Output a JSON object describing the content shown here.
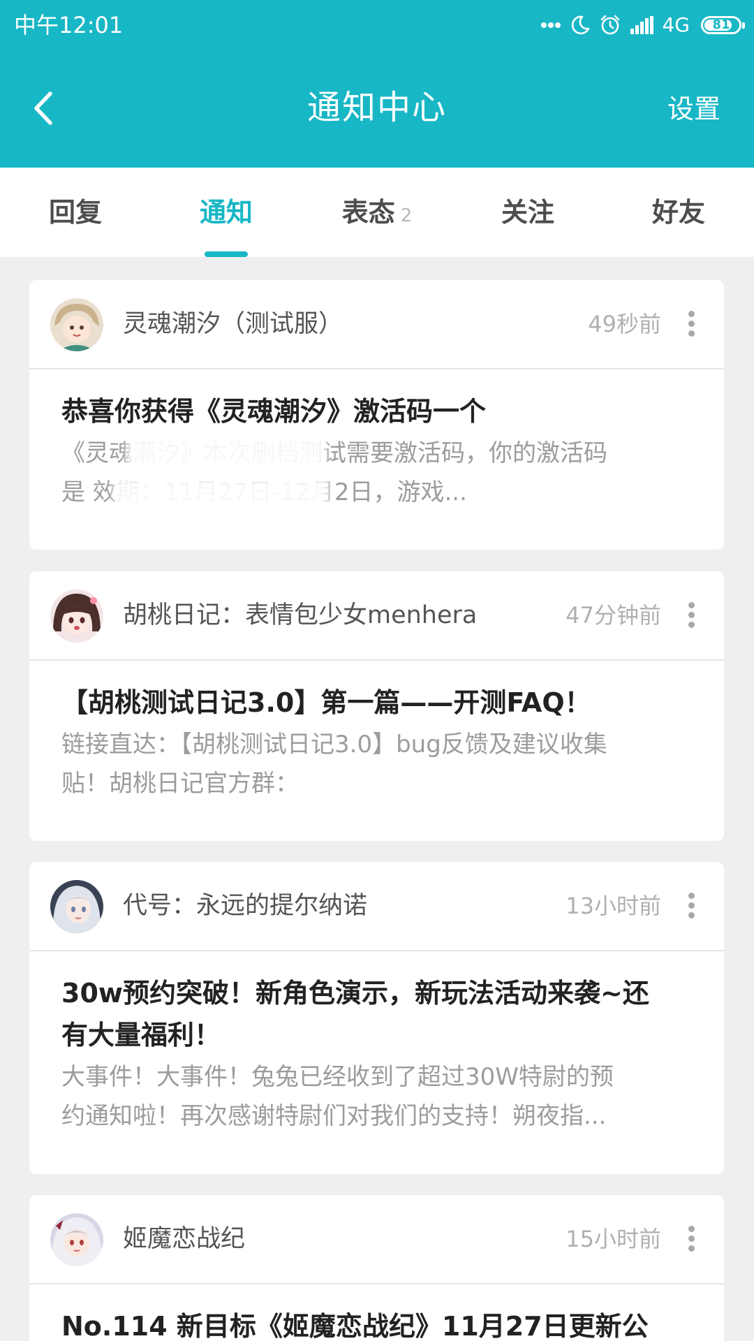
{
  "status_bar": {
    "time": "中午12:01",
    "network": "4G",
    "battery": "81",
    "battery_level": 0.81,
    "icons": [
      "more-dots-icon",
      "moon-icon",
      "alarm-icon",
      "signal-icon"
    ]
  },
  "header": {
    "title": "通知中心",
    "settings_label": "设置",
    "back_icon": "chevron-left-icon"
  },
  "tabs": [
    {
      "label": "回复",
      "badge": "",
      "active": false
    },
    {
      "label": "通知",
      "badge": "",
      "active": true
    },
    {
      "label": "表态",
      "badge": "2",
      "active": false
    },
    {
      "label": "关注",
      "badge": "",
      "active": false
    },
    {
      "label": "好友",
      "badge": "",
      "active": false
    }
  ],
  "notifications": [
    {
      "author": "灵魂潮汐（测试服）",
      "time": "49秒前",
      "title": "恭喜你获得《灵魂潮汐》激活码一个",
      "summary_line1": "《灵魂潮汐》本次删档测试需要激活码，你的激活码",
      "summary_line2": "是                                    效期：11月27日-12月2日，游戏..."
    },
    {
      "author": "胡桃日记：表情包少女menhera",
      "time": "47分钟前",
      "title": "【胡桃测试日记3.0】第一篇——开测FAQ！",
      "summary_line1": "链接直达：【胡桃测试日记3.0】bug反馈及建议收集",
      "summary_line2": "贴！胡桃日记官方群："
    },
    {
      "author": "代号：永远的提尔纳诺",
      "time": "13小时前",
      "title_line1": "30w预约突破！新角色演示，新玩法活动来袭~还",
      "title_line2": "有大量福利！",
      "summary_line1": "大事件！大事件！兔兔已经收到了超过30W特尉的预",
      "summary_line2": "约通知啦！再次感谢特尉们对我们的支持！朔夜指..."
    },
    {
      "author": "姬魔恋战纪",
      "time": "15小时前",
      "title": "No.114 新目标《姬魔恋战纪》11月27日更新公"
    }
  ]
}
